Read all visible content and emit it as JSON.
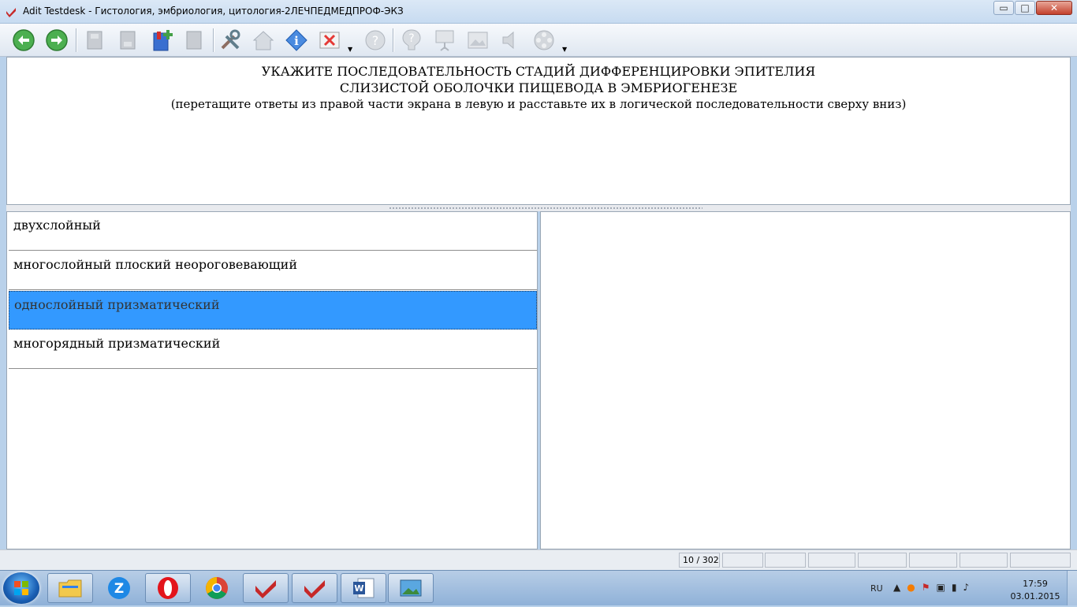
{
  "window": {
    "title": "Adit Testdesk - Гистология, эмбриология, цитология-2ЛЕЧПЕДМЕДПРОФ-ЭКЗ",
    "min_glyph": "▭",
    "max_glyph": "□",
    "close_glyph": "✕"
  },
  "toolbar": {
    "items": [
      {
        "icon": "back-arrow-icon",
        "enabled": true
      },
      {
        "icon": "forward-arrow-icon",
        "enabled": true
      },
      {
        "icon": "save-icon",
        "enabled": false
      },
      {
        "icon": "save-as-icon",
        "enabled": false
      },
      {
        "icon": "bookmark-add-icon",
        "enabled": true
      },
      {
        "icon": "bookmark-icon",
        "enabled": false
      },
      {
        "icon": "tools-icon",
        "enabled": true
      },
      {
        "icon": "home-icon",
        "enabled": false
      },
      {
        "icon": "info-icon",
        "enabled": true
      },
      {
        "icon": "cancel-icon",
        "enabled": true
      },
      {
        "icon": "help-icon",
        "enabled": false
      },
      {
        "icon": "hint-icon",
        "enabled": false
      },
      {
        "icon": "presentation-icon",
        "enabled": false
      },
      {
        "icon": "image-icon",
        "enabled": false
      },
      {
        "icon": "sound-icon",
        "enabled": false
      },
      {
        "icon": "video-icon",
        "enabled": false
      }
    ]
  },
  "question": {
    "line1": "УКАЖИТЕ  ПОСЛЕДОВАТЕЛЬНОСТЬ СТАДИЙ ДИФФЕРЕНЦИРОВКИ ЭПИТЕЛИЯ",
    "line2": "СЛИЗИСТОЙ ОБОЛОЧКИ ПИЩЕВОДА В ЭМБРИОГЕНЕЗЕ",
    "instruction": "(перетащите ответы из правой части экрана в левую и расставьте их в логической последовательности сверху вниз)"
  },
  "answers": [
    {
      "text": "двухслойный",
      "selected": false
    },
    {
      "text": "многослойный плоский неороговевающий",
      "selected": false
    },
    {
      "text": "однослойный призматический",
      "selected": true
    },
    {
      "text": "многорядный призматический",
      "selected": false
    }
  ],
  "status": {
    "progress": "10 / 302"
  },
  "taskbar": {
    "apps": [
      "explorer-icon",
      "zoom-icon",
      "opera-icon",
      "chrome-icon",
      "testdesk-icon",
      "testdesk-icon",
      "word-icon",
      "picture-viewer-icon"
    ],
    "language": "RU",
    "time": "17:59",
    "date": "03.01.2015"
  },
  "colors": {
    "selection": "#3399ff",
    "title_bar": "#c7dbf1",
    "taskbar": "#8fb1d8"
  }
}
